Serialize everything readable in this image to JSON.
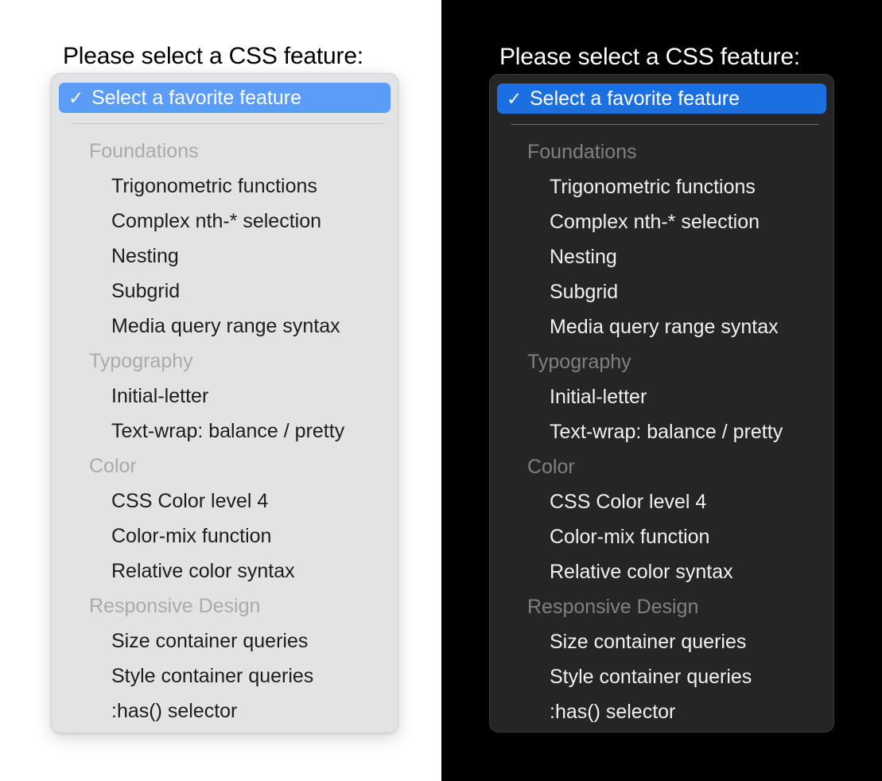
{
  "prompt": "Please select a CSS feature:",
  "select": {
    "selected_option": "Select a favorite feature",
    "check_icon": "✓",
    "groups": [
      {
        "label": "Foundations",
        "options": [
          "Trigonometric functions",
          "Complex nth-* selection",
          "Nesting",
          "Subgrid",
          "Media query range syntax"
        ]
      },
      {
        "label": "Typography",
        "options": [
          "Initial-letter",
          "Text-wrap: balance / pretty"
        ]
      },
      {
        "label": "Color",
        "options": [
          "CSS Color level 4",
          "Color-mix function",
          "Relative color syntax"
        ]
      },
      {
        "label": "Responsive Design",
        "options": [
          "Size container queries",
          "Style container queries",
          ":has() selector"
        ]
      }
    ]
  },
  "themes": {
    "light": {
      "name": "light",
      "page_background": "#ffffff",
      "popup_background": "#e2e3e5",
      "highlight_color": "#5b9cf8",
      "text_color": "#1d1d1f",
      "group_label_color": "#a9aaac",
      "separator_color": "#c3c4c6"
    },
    "dark": {
      "name": "dark",
      "page_background": "#000000",
      "popup_background": "#262525",
      "highlight_color": "#1c6fe0",
      "text_color": "#f0f0f0",
      "group_label_color": "#808080",
      "separator_color": "#6b6a6a"
    }
  }
}
